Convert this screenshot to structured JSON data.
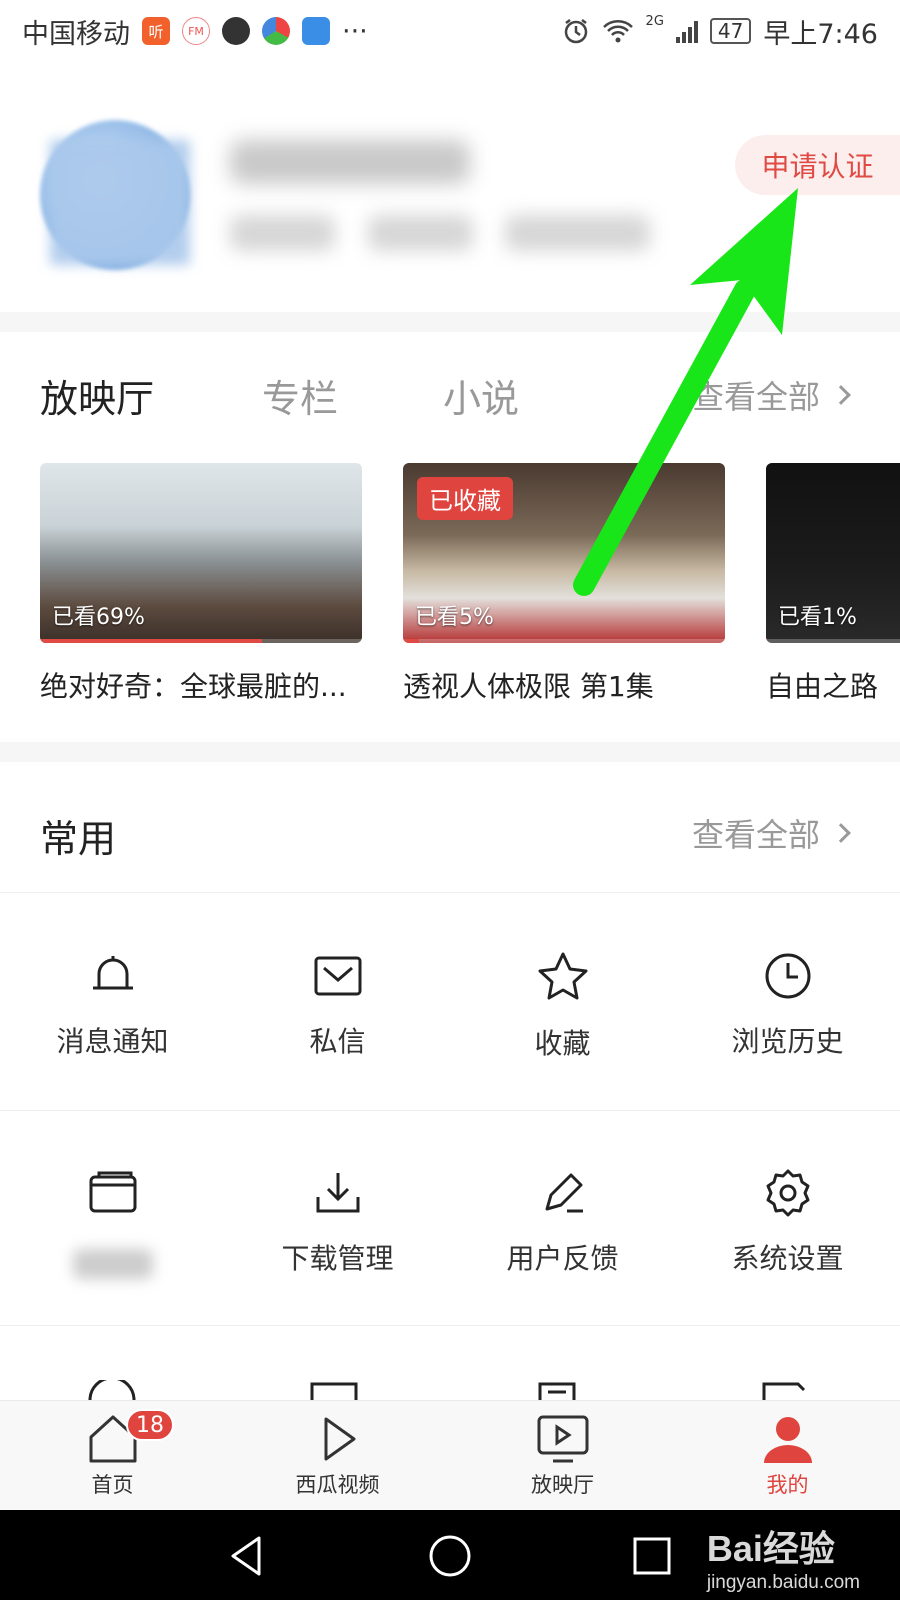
{
  "status_bar": {
    "carrier": "中国移动",
    "app_ting": "听",
    "app_fm": "FM",
    "more": "···",
    "network": "2G",
    "battery": "47",
    "time": "早上7:46"
  },
  "profile": {
    "certify_label": "申请认证"
  },
  "theater": {
    "tabs": [
      "放映厅",
      "专栏",
      "小说"
    ],
    "view_all": "查看全部",
    "cards": [
      {
        "title": "绝对好奇：全球最脏的...",
        "progress_label": "已看69%",
        "progress": 0.69,
        "tag": ""
      },
      {
        "title": "透视人体极限 第1集",
        "progress_label": "已看5%",
        "progress": 0.05,
        "tag": "已收藏"
      },
      {
        "title": "自由之路",
        "progress_label": "已看1%",
        "progress": 0.01,
        "tag": ""
      }
    ]
  },
  "common": {
    "title": "常用",
    "view_all": "查看全部",
    "row1": [
      "消息通知",
      "私信",
      "收藏",
      "浏览历史"
    ],
    "row2": [
      "",
      "下载管理",
      "用户反馈",
      "系统设置"
    ]
  },
  "bottom_nav": {
    "items": [
      "首页",
      "西瓜视频",
      "放映厅",
      "我的"
    ],
    "home_badge": "18",
    "active": "我的",
    "accent": "#e0443f"
  },
  "watermark": {
    "main": "Bai经验",
    "sub": "jingyan.baidu.com"
  }
}
